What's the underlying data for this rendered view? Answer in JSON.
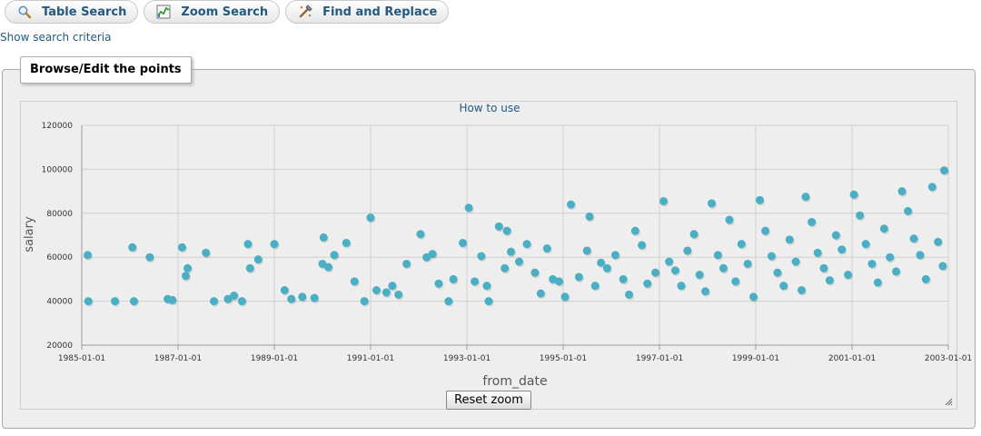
{
  "toolbar": {
    "table_search": "Table Search",
    "zoom_search": "Zoom Search",
    "find_replace": "Find and Replace"
  },
  "criteria_link": "Show search criteria",
  "legend": "Browse/Edit the points",
  "how_to_use": "How to use",
  "reset_zoom": "Reset zoom",
  "icons": [
    "search-icon",
    "zoom-chart-icon",
    "find-replace-icon",
    "resize-handle-icon"
  ],
  "colors": {
    "point": "#4aaec4",
    "link": "#235a81",
    "grid": "#d0d0d0"
  },
  "chart_data": {
    "type": "scatter",
    "title": "",
    "xlabel": "from_date",
    "ylabel": "salary",
    "x_ticks": [
      "1985-01-01",
      "1987-01-01",
      "1989-01-01",
      "1991-01-01",
      "1993-01-01",
      "1995-01-01",
      "1997-01-01",
      "1999-01-01",
      "2001-01-01",
      "2003-01-01"
    ],
    "y_ticks": [
      20000,
      40000,
      60000,
      80000,
      100000,
      120000
    ],
    "ylim": [
      20000,
      120000
    ],
    "xlim": [
      "1985-01-01",
      "2003-01-01"
    ],
    "grid": true,
    "points": [
      [
        "1985-02-15",
        61000
      ],
      [
        "1985-02-20",
        40000
      ],
      [
        "1985-09-10",
        40000
      ],
      [
        "1986-02-01",
        40000
      ],
      [
        "1986-01-20",
        64500
      ],
      [
        "1986-06-01",
        60000
      ],
      [
        "1986-10-15",
        41000
      ],
      [
        "1986-11-20",
        40500
      ],
      [
        "1987-02-01",
        64500
      ],
      [
        "1987-03-15",
        55000
      ],
      [
        "1987-03-01",
        51500
      ],
      [
        "1987-08-01",
        62000
      ],
      [
        "1987-10-01",
        40000
      ],
      [
        "1988-01-15",
        41000
      ],
      [
        "1988-03-01",
        42500
      ],
      [
        "1988-05-01",
        40000
      ],
      [
        "1988-07-01",
        55000
      ],
      [
        "1988-06-15",
        66000
      ],
      [
        "1988-09-01",
        59000
      ],
      [
        "1989-01-01",
        66000
      ],
      [
        "1989-03-20",
        45000
      ],
      [
        "1989-05-10",
        41000
      ],
      [
        "1989-08-01",
        42000
      ],
      [
        "1989-11-01",
        41500
      ],
      [
        "1990-01-01",
        57000
      ],
      [
        "1990-02-15",
        55500
      ],
      [
        "1990-01-10",
        69000
      ],
      [
        "1990-04-01",
        61000
      ],
      [
        "1990-07-01",
        66500
      ],
      [
        "1990-09-01",
        49000
      ],
      [
        "1990-11-15",
        40000
      ],
      [
        "1991-01-01",
        78000
      ],
      [
        "1991-02-15",
        45000
      ],
      [
        "1991-05-01",
        44000
      ],
      [
        "1991-06-15",
        47000
      ],
      [
        "1991-08-01",
        43000
      ],
      [
        "1991-10-01",
        57000
      ],
      [
        "1992-01-15",
        70500
      ],
      [
        "1992-03-01",
        60000
      ],
      [
        "1992-04-15",
        61500
      ],
      [
        "1992-06-01",
        48000
      ],
      [
        "1992-08-15",
        40000
      ],
      [
        "1992-09-20",
        50000
      ],
      [
        "1992-12-01",
        66500
      ],
      [
        "1993-01-15",
        82500
      ],
      [
        "1993-03-01",
        49000
      ],
      [
        "1993-04-20",
        60500
      ],
      [
        "1993-06-01",
        47000
      ],
      [
        "1993-06-15",
        40000
      ],
      [
        "1993-09-01",
        74000
      ],
      [
        "1993-11-01",
        72000
      ],
      [
        "1993-10-15",
        55000
      ],
      [
        "1993-12-01",
        62500
      ],
      [
        "1994-02-01",
        58000
      ],
      [
        "1994-04-01",
        66000
      ],
      [
        "1994-06-01",
        53000
      ],
      [
        "1994-07-15",
        43500
      ],
      [
        "1994-09-01",
        64000
      ],
      [
        "1994-10-15",
        50000
      ],
      [
        "1994-12-01",
        49000
      ],
      [
        "1995-01-15",
        42000
      ],
      [
        "1995-03-01",
        84000
      ],
      [
        "1995-05-01",
        51000
      ],
      [
        "1995-07-01",
        63000
      ],
      [
        "1995-07-20",
        78500
      ],
      [
        "1995-09-01",
        47000
      ],
      [
        "1995-10-15",
        57500
      ],
      [
        "1995-12-01",
        55000
      ],
      [
        "1996-02-01",
        61000
      ],
      [
        "1996-04-01",
        50000
      ],
      [
        "1996-05-15",
        43000
      ],
      [
        "1996-07-01",
        72000
      ],
      [
        "1996-08-20",
        65500
      ],
      [
        "1996-10-01",
        48000
      ],
      [
        "1996-12-01",
        53000
      ],
      [
        "1997-02-01",
        85500
      ],
      [
        "1997-03-15",
        58000
      ],
      [
        "1997-05-01",
        54000
      ],
      [
        "1997-06-15",
        47000
      ],
      [
        "1997-08-01",
        63000
      ],
      [
        "1997-09-20",
        70500
      ],
      [
        "1997-11-01",
        52000
      ],
      [
        "1997-12-15",
        44500
      ],
      [
        "1998-02-01",
        84500
      ],
      [
        "1998-03-20",
        61000
      ],
      [
        "1998-05-01",
        55000
      ],
      [
        "1998-06-15",
        77000
      ],
      [
        "1998-08-01",
        49000
      ],
      [
        "1998-09-15",
        66000
      ],
      [
        "1998-11-01",
        57000
      ],
      [
        "1998-12-15",
        42000
      ],
      [
        "1999-02-01",
        86000
      ],
      [
        "1999-03-15",
        72000
      ],
      [
        "1999-05-01",
        60500
      ],
      [
        "1999-06-15",
        53000
      ],
      [
        "1999-08-01",
        47000
      ],
      [
        "1999-09-15",
        68000
      ],
      [
        "1999-11-01",
        58000
      ],
      [
        "1999-12-15",
        45000
      ],
      [
        "2000-01-15",
        87500
      ],
      [
        "2000-03-01",
        76000
      ],
      [
        "2000-04-15",
        62000
      ],
      [
        "2000-06-01",
        55000
      ],
      [
        "2000-07-15",
        49500
      ],
      [
        "2000-09-01",
        70000
      ],
      [
        "2000-10-15",
        63500
      ],
      [
        "2000-12-01",
        52000
      ],
      [
        "2001-01-15",
        88500
      ],
      [
        "2001-03-01",
        79000
      ],
      [
        "2001-04-15",
        66000
      ],
      [
        "2001-06-01",
        57000
      ],
      [
        "2001-07-15",
        48500
      ],
      [
        "2001-09-01",
        73000
      ],
      [
        "2001-10-15",
        60000
      ],
      [
        "2001-12-01",
        53500
      ],
      [
        "2002-01-15",
        90000
      ],
      [
        "2002-03-01",
        81000
      ],
      [
        "2002-04-15",
        68500
      ],
      [
        "2002-06-01",
        61000
      ],
      [
        "2002-07-15",
        50000
      ],
      [
        "2002-09-01",
        92000
      ],
      [
        "2002-10-15",
        67000
      ],
      [
        "2002-11-20",
        56000
      ],
      [
        "2002-12-01",
        99500
      ]
    ]
  }
}
